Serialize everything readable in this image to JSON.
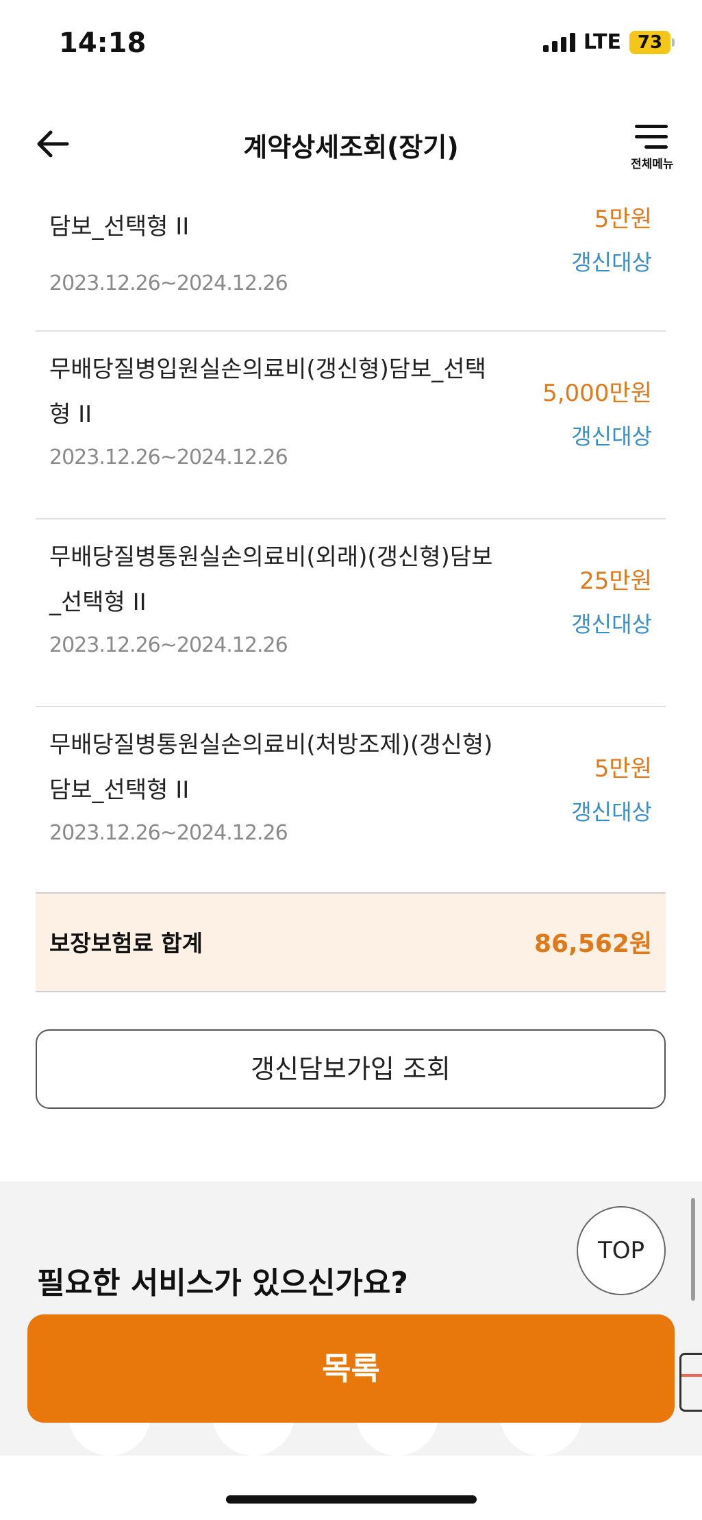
{
  "status_bar": {
    "time": "14:18",
    "network": "LTE",
    "battery": "73"
  },
  "header": {
    "title": "계약상세조회(장기)",
    "menu_label": "전체메뉴"
  },
  "coverages": [
    {
      "name_line1": "담보_선택형 II",
      "name_line2": "",
      "period": "2023.12.26~2024.12.26",
      "amount": "5만원",
      "status": "갱신대상"
    },
    {
      "name_line1": "무배당질병입원실손의료비(갱신형)담보_선택",
      "name_line2": "형 II",
      "period": "2023.12.26~2024.12.26",
      "amount": "5,000만원",
      "status": "갱신대상"
    },
    {
      "name_line1": "무배당질병통원실손의료비(외래)(갱신형)담보",
      "name_line2": "_선택형 II",
      "period": "2023.12.26~2024.12.26",
      "amount": "25만원",
      "status": "갱신대상"
    },
    {
      "name_line1": "무배당질병통원실손의료비(처방조제)(갱신형)",
      "name_line2": "담보_선택형 II",
      "period": "2023.12.26~2024.12.26",
      "amount": "5만원",
      "status": "갱신대상"
    }
  ],
  "total": {
    "label": "보장보험료 합계",
    "value": "86,562원"
  },
  "renew_button": "갱신담보가입 조회",
  "service_section": {
    "heading": "필요한 서비스가 있으신가요?"
  },
  "top_button": "TOP",
  "list_button": "목록"
}
